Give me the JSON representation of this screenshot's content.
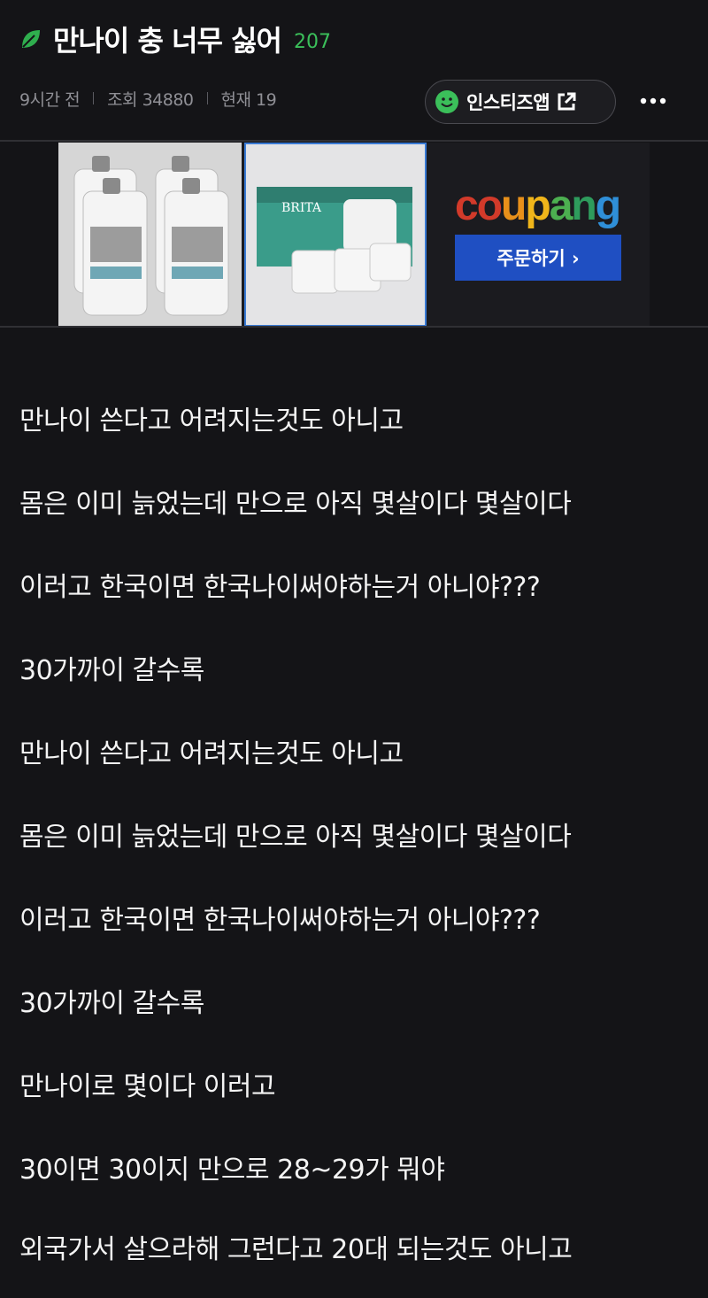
{
  "post": {
    "title": "만나이 충 너무 싫어",
    "comment_count": "207",
    "time": "9시간 전",
    "views": "조회 34880",
    "current": "현재 19"
  },
  "actions": {
    "insti_app_label": "인스티즈앱",
    "more_icon": "more-horizontal-icon"
  },
  "ad": {
    "brand": "coupang",
    "brand_colors": [
      "#e32b2b",
      "#f39c12",
      "#f7c31a",
      "#2ecc40",
      "#27ae60",
      "#2f8fd8",
      "#1e6fd1"
    ],
    "product2_label": "BRITA",
    "order_label": "주문하기 ›"
  },
  "body": {
    "paragraphs": [
      "만나이 쓴다고 어려지는것도 아니고",
      "몸은 이미 늙었는데 만으로 아직 몇살이다 몇살이다",
      "이러고 한국이면 한국나이써야하는거 아니야???",
      "30가까이 갈수록",
      "만나이 쓴다고 어려지는것도 아니고",
      "몸은 이미 늙었는데 만으로 아직 몇살이다 몇살이다",
      "이러고 한국이면 한국나이써야하는거 아니야???",
      "30가까이 갈수록",
      "만나이로 몇이다 이러고",
      "30이면 30이지 만으로 28~29가 뭐야",
      "외국가서 살으라해 그런다고 20대 되는것도 아니고"
    ]
  },
  "colors": {
    "background": "#141417",
    "accent_green": "#3bbf5a",
    "meta_gray": "#8f8f95"
  }
}
